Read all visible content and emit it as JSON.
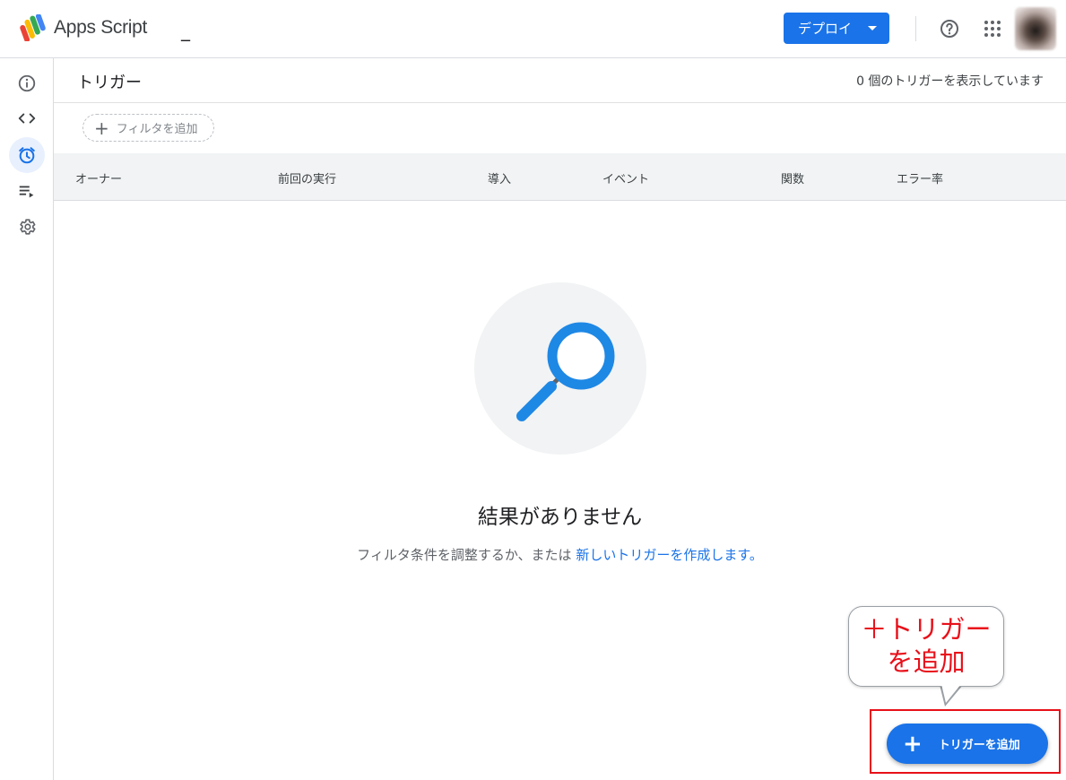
{
  "header": {
    "app_title": "Apps Script",
    "project_name": "_",
    "deploy_label": "デプロイ",
    "icons": [
      "apps-script-logo",
      "help-icon",
      "apps-grid-icon",
      "avatar"
    ]
  },
  "rail": {
    "items": [
      {
        "icon": "info-icon",
        "active": false
      },
      {
        "icon": "code-icon",
        "active": false
      },
      {
        "icon": "alarm-icon",
        "active": true
      },
      {
        "icon": "executions-icon",
        "active": false
      },
      {
        "icon": "gear-icon",
        "active": false
      }
    ]
  },
  "page": {
    "title": "トリガー",
    "count_text": "0 個のトリガーを表示しています",
    "filter_label": "フィルタを追加"
  },
  "table": {
    "columns": [
      "オーナー",
      "前回の実行",
      "導入",
      "イベント",
      "関数",
      "エラー率"
    ]
  },
  "empty_state": {
    "title": "結果がありません",
    "subtitle_prefix": "フィルタ条件を調整するか、または ",
    "subtitle_link": "新しいトリガーを作成します。"
  },
  "callout": {
    "line1": "＋トリガー",
    "line2": "を追加"
  },
  "fab": {
    "label": "トリガーを追加"
  },
  "colors": {
    "primary": "#1a73e8",
    "annotation_red": "#e8101a",
    "empty_bg": "#f1f3f4",
    "magnifier_blue": "#1e88e5"
  }
}
